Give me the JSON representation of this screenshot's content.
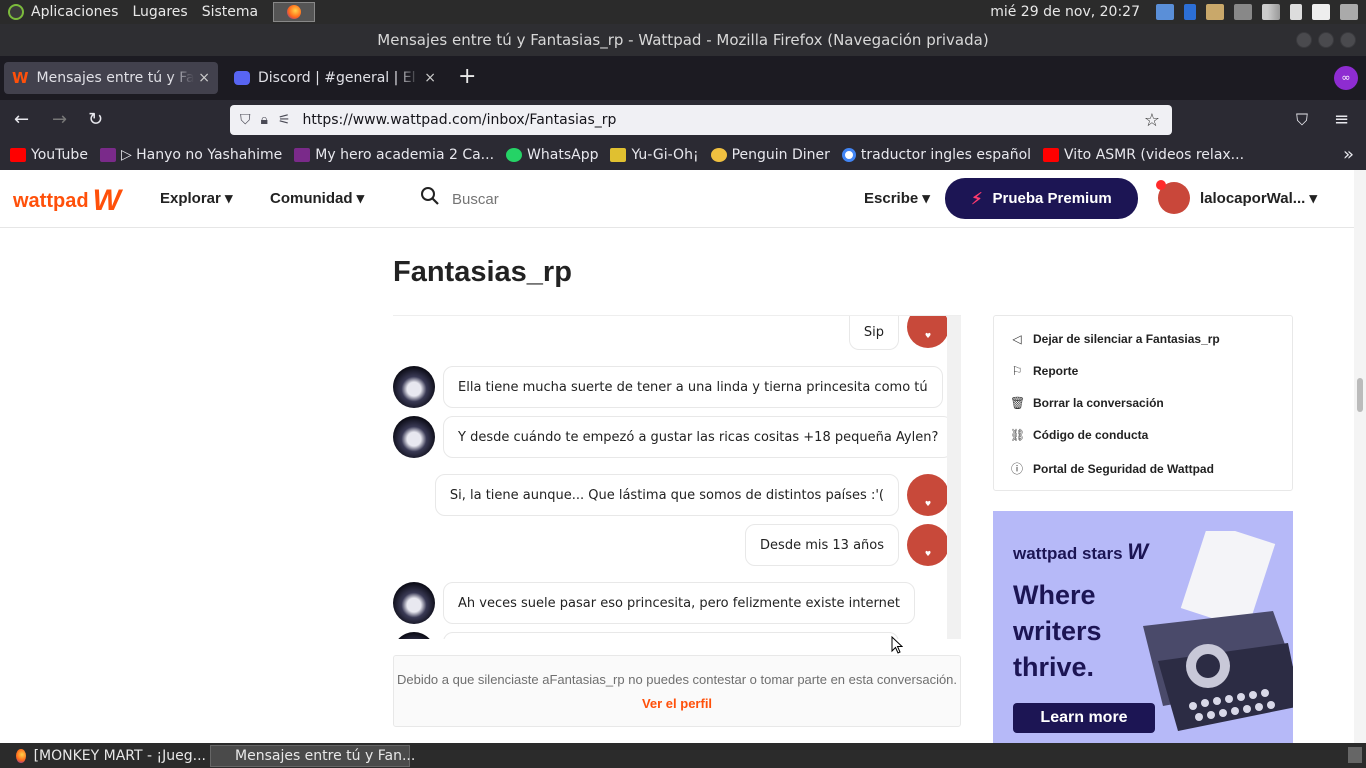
{
  "system": {
    "menu": [
      "Aplicaciones",
      "Lugares",
      "Sistema"
    ],
    "clock": "mié 29 de nov, 20:27"
  },
  "window": {
    "title": "Mensajes entre tú y Fantasias_rp - Wattpad - Mozilla Firefox (Navegación privada)"
  },
  "tabs": [
    {
      "label": "Mensajes entre tú y Fantasias_rp",
      "close": "×"
    },
    {
      "label": "Discord | #general | El servidor",
      "close": "×"
    }
  ],
  "newtab": "+",
  "url": "https://www.wattpad.com/inbox/Fantasias_rp",
  "bookmarks": [
    {
      "label": "YouTube",
      "color": "#ff0000"
    },
    {
      "label": "▷ Hanyo no Yashahime",
      "color": "#7a2a8a"
    },
    {
      "label": "My hero academia 2 Ca...",
      "color": "#7a2a8a"
    },
    {
      "label": "WhatsApp",
      "color": "#25d366"
    },
    {
      "label": "Yu-Gi-Oh¡",
      "color": "#e0c030"
    },
    {
      "label": "Penguin Diner",
      "color": "#f0c040"
    },
    {
      "label": "traductor ingles español",
      "color": "#4285f4"
    },
    {
      "label": "Vito ASMR (videos relax...",
      "color": "#ff0000"
    }
  ],
  "wattpad": {
    "logo": "wattpad",
    "explore": "Explorar",
    "community": "Comunidad",
    "search_placeholder": "Buscar",
    "write": "Escribe",
    "premium": "Prueba Premium",
    "username": "lalocaporWal..."
  },
  "conversation": {
    "title": "Fantasias_rp",
    "messages": [
      {
        "side": "right",
        "text": "Sip"
      },
      {
        "side": "left",
        "text": "Ella tiene mucha suerte de tener a una linda y tierna princesita como tú"
      },
      {
        "side": "left",
        "text": "Y desde cuándo te empezó a gustar las ricas cositas +18 pequeña Aylen?"
      },
      {
        "side": "right",
        "text": "Si, la tiene aunque... Que lástima que somos de distintos países :'("
      },
      {
        "side": "right",
        "text": "Desde mis 13 años"
      },
      {
        "side": "left",
        "text": "Ah veces suele pasar eso princesita, pero felizmente existe internet"
      }
    ],
    "muted_notice": "Debido a que silenciaste aFantasias_rp no puedes contestar o tomar parte en esta conversación.",
    "profile_link": "Ver el perfil"
  },
  "options": [
    {
      "label": "Dejar de silenciar a Fantasias_rp",
      "icon": "speaker-icon"
    },
    {
      "label": "Reporte",
      "icon": "flag-icon"
    },
    {
      "label": "Borrar la conversación",
      "icon": "trash-icon"
    },
    {
      "label": "Código de conducta",
      "icon": "link-icon"
    },
    {
      "label": "Portal de Seguridad de Wattpad",
      "icon": "info-icon"
    }
  ],
  "ad": {
    "brand": "wattpad stars",
    "headline": "Where writers thrive.",
    "cta": "Learn more"
  },
  "taskbar": [
    {
      "label": "[MONKEY MART - ¡Jueg..."
    },
    {
      "label": "Mensajes entre tú y Fan..."
    }
  ]
}
